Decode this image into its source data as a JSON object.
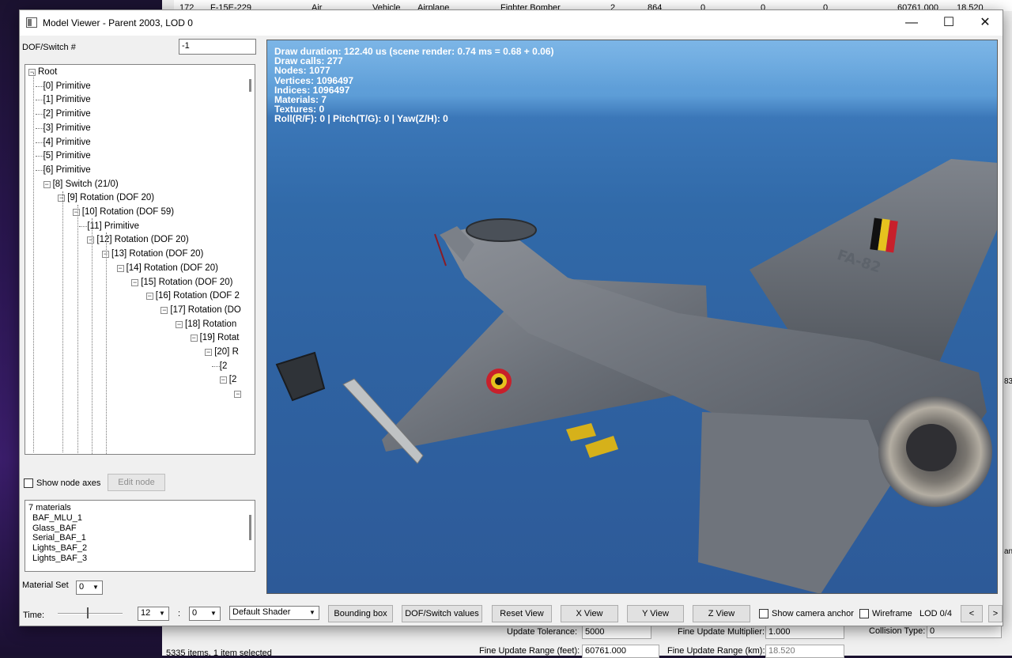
{
  "background_app": {
    "row": [
      "172",
      "F-15E-229",
      "Air",
      "Vehicle",
      "Airplane",
      "Fighter Bomber",
      "2",
      "864",
      "0",
      "0",
      "0",
      "60761.000",
      "18.520"
    ],
    "update_tolerance_label": "Update Tolerance:",
    "update_tolerance_value": "5000",
    "fine_mult_label": "Fine Update Multiplier:",
    "fine_mult_value": "1.000",
    "collision_label": "Collision Type:",
    "collision_value": "0",
    "fine_range_feet_label": "Fine Update Range (feet):",
    "fine_range_feet_value": "60761.000",
    "fine_range_km_label": "Fine Update Range (km):",
    "fine_range_km_value": "18.520",
    "status_text": "5335 items, 1 item selected",
    "side_fragment": "an",
    "side_fragment2": "83"
  },
  "window": {
    "title": "Model Viewer - Parent 2003, LOD 0",
    "minimize": "—",
    "maximize": "☐",
    "close": "✕"
  },
  "left_panel": {
    "dof_label": "DOF/Switch #",
    "dof_value": "-1",
    "tree": [
      {
        "label": "Root",
        "toggle": "−"
      },
      {
        "label": "[0] Primitive"
      },
      {
        "label": "[1] Primitive"
      },
      {
        "label": "[2] Primitive"
      },
      {
        "label": "[3] Primitive"
      },
      {
        "label": "[4] Primitive"
      },
      {
        "label": "[5] Primitive"
      },
      {
        "label": "[6] Primitive"
      },
      {
        "label": "[8] Switch (21/0)",
        "toggle": "−"
      },
      {
        "label": "[9] Rotation (DOF 20)",
        "toggle": "−"
      },
      {
        "label": "[10] Rotation (DOF 59)",
        "toggle": "−"
      },
      {
        "label": "[11] Primitive"
      },
      {
        "label": "[12] Rotation (DOF 20)",
        "toggle": "−"
      },
      {
        "label": "[13] Rotation (DOF 20)",
        "toggle": "−"
      },
      {
        "label": "[14] Rotation (DOF 20)",
        "toggle": "−"
      },
      {
        "label": "[15] Rotation (DOF 20)",
        "toggle": "−"
      },
      {
        "label": "[16] Rotation (DOF 2",
        "toggle": "−"
      },
      {
        "label": "[17] Rotation (DO",
        "toggle": "−"
      },
      {
        "label": "[18] Rotation",
        "toggle": "−"
      },
      {
        "label": "[19] Rotat",
        "toggle": "−"
      },
      {
        "label": "[20] R",
        "toggle": "−"
      },
      {
        "label": "[2"
      },
      {
        "label": "[2",
        "toggle": "−"
      },
      {
        "label": "",
        "toggle": "−"
      }
    ],
    "show_node_axes_label": "Show node axes",
    "show_node_axes_checked": false,
    "edit_node_label": "Edit node",
    "materials": [
      "7 materials",
      "BAF_MLU_1",
      "Glass_BAF",
      "Serial_BAF_1",
      "Lights_BAF_2",
      "Lights_BAF_3"
    ],
    "material_set_label": "Material Set",
    "material_set_value": "0"
  },
  "viewport": {
    "stats": [
      "Draw duration: 122.40 us (scene render: 0.74 ms = 0.68 + 0.06)",
      "Draw calls: 277",
      "Nodes: 1077",
      "Vertices: 1096497",
      "Indices: 1096497",
      "Materials: 7",
      "Textures: 0",
      "Roll(R/F): 0 | Pitch(T/G): 0 | Yaw(Z/H): 0"
    ],
    "tail_serial": "FA-82"
  },
  "bottom_bar": {
    "time_label": "Time:",
    "time_slider_fraction": 0.45,
    "hour_value": "12",
    "colon": ":",
    "minute_value": "0",
    "shader_value": "Default Shader",
    "bounding_box_label": "Bounding box",
    "dof_values_label": "DOF/Switch values",
    "reset_view_label": "Reset View",
    "x_view_label": "X View",
    "y_view_label": "Y View",
    "z_view_label": "Z View",
    "camera_anchor_label": "Show camera anchor",
    "camera_anchor_checked": false,
    "wireframe_label": "Wireframe",
    "wireframe_checked": false,
    "lod_label": "LOD 0/4",
    "prev_label": "<",
    "next_label": ">"
  }
}
